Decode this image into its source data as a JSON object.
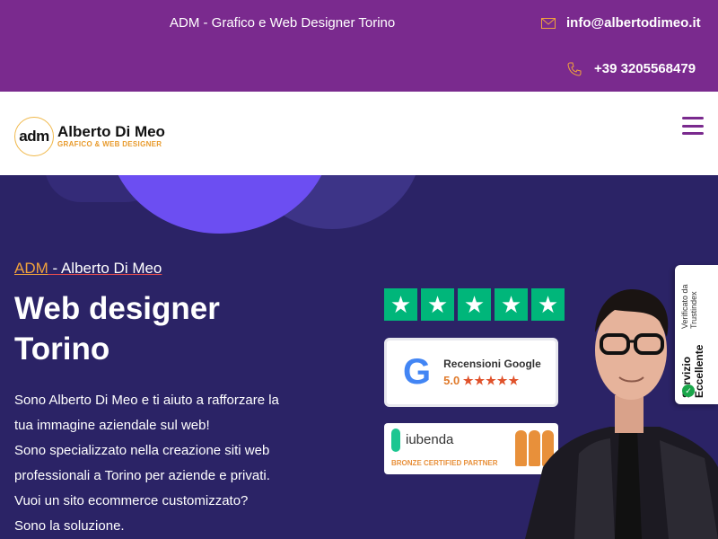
{
  "topbar": {
    "tagline": "ADM - Grafico e Web Designer Torino",
    "email": "info@albertodimeo.it",
    "phone": "+39 3205568479",
    "email_icon": "mail-icon",
    "phone_icon": "phone-icon"
  },
  "header": {
    "logo_mark": "adm",
    "logo_name": "Alberto Di Meo",
    "logo_sub": "GRAFICO & WEB DESIGNER",
    "menu_icon": "hamburger-menu-icon"
  },
  "hero": {
    "kicker_brand": "ADM",
    "kicker_rest": " - Alberto Di Meo",
    "title_line1": "Web designer",
    "title_line2": "Torino",
    "desc_lines": [
      "Sono Alberto Di Meo e ti aiuto a rafforzare la",
      "tua immagine aziendale sul web!",
      "Sono specializzato nella creazione siti web",
      "professionali a Torino per aziende e privati.",
      "Vuoi un sito ecommerce customizzato?",
      "Sono la soluzione."
    ]
  },
  "badges": {
    "trustpilot_stars": 5,
    "google_label": "Recensioni Google",
    "google_score": "5.0",
    "google_stars": "★★★★★",
    "iubenda_name": "iubenda",
    "iubenda_partner": "BRONZE CERTIFIED PARTNER"
  },
  "trustindex": {
    "main": "Servizio Eccellente",
    "sub": "Verificato da Trustindex"
  },
  "colors": {
    "topbar": "#7a2a8e",
    "hero_bg": "#2b2366",
    "accent_orange": "#f0a23c",
    "trust_green": "#00b67a"
  }
}
